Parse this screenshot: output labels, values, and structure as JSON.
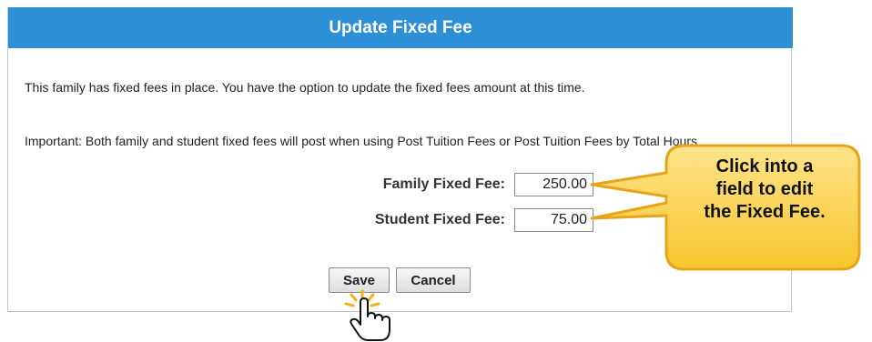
{
  "dialog": {
    "title": "Update Fixed Fee",
    "message": "This family has fixed fees in place. You have the option to update the fixed fees amount at this time.",
    "important_note": "Important: Both family and student fixed fees will post when using Post Tuition Fees or Post Tuition Fees by Total Hours."
  },
  "fields": {
    "family_label": "Family Fixed Fee:",
    "family_value": "250.00",
    "student_label": "Student Fixed Fee:",
    "student_value": "75.00"
  },
  "buttons": {
    "save_label": "Save",
    "cancel_label": "Cancel"
  },
  "callout": {
    "line1": "Click into a",
    "line2": "field to edit",
    "line3": "the Fixed Fee.",
    "fill_color": "#f9d23c",
    "border_color": "#e7a31c"
  },
  "colors": {
    "header": "#2d8fd5"
  },
  "icons": {
    "cursor": "hand-pointer-icon",
    "click_burst": "click-burst-icon"
  }
}
